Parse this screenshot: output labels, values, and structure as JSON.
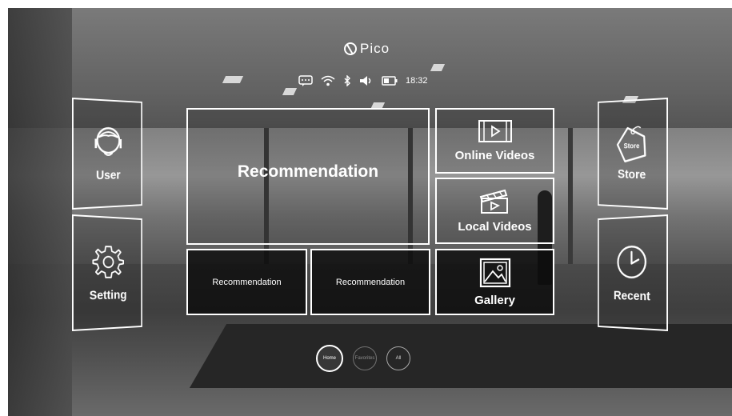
{
  "header": {
    "logo_text": "Pico",
    "status": {
      "time": "18:32",
      "icons": [
        "message-icon",
        "wifi-icon",
        "bluetooth-icon",
        "volume-icon",
        "battery-icon"
      ]
    }
  },
  "left_panels": [
    {
      "label": "User",
      "icon": "user-icon"
    },
    {
      "label": "Setting",
      "icon": "gear-icon"
    }
  ],
  "main_tiles": {
    "featured": "Recommendation",
    "small_1": "Recommendation",
    "small_2": "Recommendation"
  },
  "media_tiles": [
    {
      "label": "Online  Videos",
      "icon": "play-screen-icon"
    },
    {
      "label": "Local Videos",
      "icon": "clapperboard-icon"
    },
    {
      "label": "Gallery",
      "icon": "picture-icon"
    }
  ],
  "right_panels": [
    {
      "label": "Store",
      "icon": "store-tag-icon",
      "icon_text": "Store"
    },
    {
      "label": "Recent",
      "icon": "clock-icon"
    }
  ],
  "bottom_nav": [
    {
      "label": "Home",
      "active": true
    },
    {
      "label": "Favorites",
      "active": false
    },
    {
      "label": "All",
      "active": false
    }
  ],
  "colors": {
    "accent": "#ffffff",
    "tile_dark": "#0a0a0a"
  }
}
